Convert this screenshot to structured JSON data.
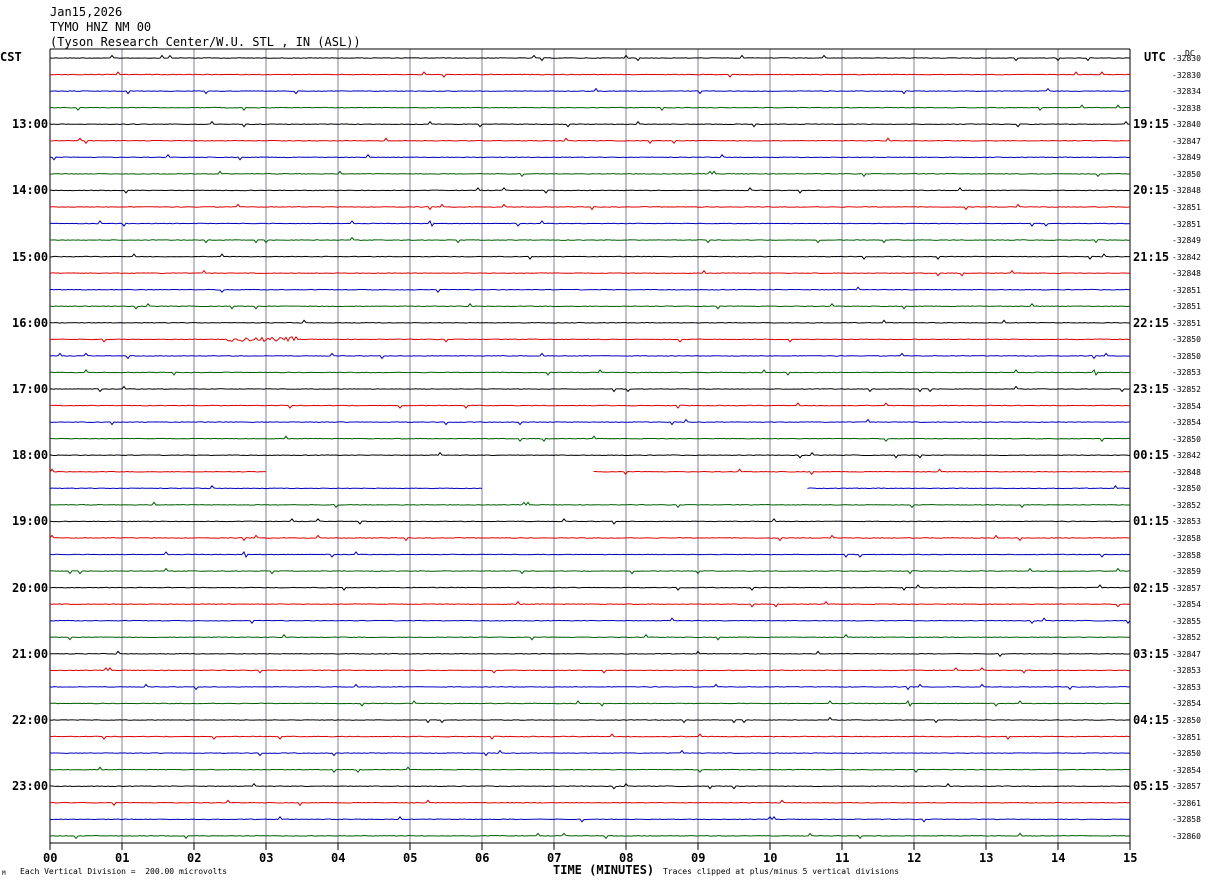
{
  "header": {
    "date": "Jan15,2026",
    "station": "TYMO HNZ NM 00",
    "location": "(Tyson Research Center/W.U. STL , IN (ASL))"
  },
  "axis": {
    "left_zone": "CST",
    "right_zone": "UTC",
    "dc_label": "DC",
    "xlabel": "TIME (MINUTES)",
    "footer_left": "Each Vertical Division =  200.00 microvolts",
    "footer_right": "Traces clipped at plus/minus 5 vertical divisions",
    "corner_mark": "M"
  },
  "colors": {
    "black": "#000000",
    "red": "#e00000",
    "blue": "#0000c0",
    "green": "#006000",
    "grid": "#8080a0"
  },
  "chart_data": {
    "type": "line",
    "title": "TYMO HNZ NM 00",
    "xlabel": "TIME (MINUTES)",
    "x_ticks": [
      "00",
      "01",
      "02",
      "03",
      "04",
      "05",
      "06",
      "07",
      "08",
      "09",
      "10",
      "11",
      "12",
      "13",
      "14",
      "15"
    ],
    "xlim": [
      0,
      15
    ],
    "trace_colors": [
      "black",
      "red",
      "blue",
      "green"
    ],
    "trace_count": 48,
    "cst_hours": [
      "13:00",
      "14:00",
      "15:00",
      "16:00",
      "17:00",
      "18:00",
      "19:00",
      "20:00",
      "21:00",
      "22:00",
      "23:00"
    ],
    "utc_hours": [
      "19:15",
      "20:15",
      "21:15",
      "22:15",
      "23:15",
      "00:15",
      "01:15",
      "02:15",
      "03:15",
      "04:15",
      "05:15"
    ],
    "dc_offsets": [
      "-32830",
      "-32830",
      "-32834",
      "-32838",
      "-32840",
      "-32847",
      "-32849",
      "-32850",
      "-32848",
      "-32851",
      "-32851",
      "-32849",
      "-32842",
      "-32848",
      "-32851",
      "-32851",
      "-32851",
      "-32850",
      "-32850",
      "-32853",
      "-32852",
      "-32854",
      "-32854",
      "-32850",
      "-32842",
      "-32848",
      "-32850",
      "-32852",
      "-32853",
      "-32858",
      "-32858",
      "-32859",
      "-32857",
      "-32854",
      "-32855",
      "-32852",
      "-32847",
      "-32853",
      "-32853",
      "-32854",
      "-32850",
      "-32851",
      "-32850",
      "-32854",
      "-32857",
      "-32861",
      "-32858",
      "-32860"
    ],
    "gaps": [
      {
        "trace": 25,
        "start_min": 3.0,
        "end_min": 7.55
      },
      {
        "trace": 26,
        "start_min": 6.0,
        "end_min": 10.52
      }
    ],
    "events": [
      {
        "trace": 17,
        "start_min": 2.45,
        "end_min": 3.4,
        "amplitude": 4
      }
    ]
  }
}
